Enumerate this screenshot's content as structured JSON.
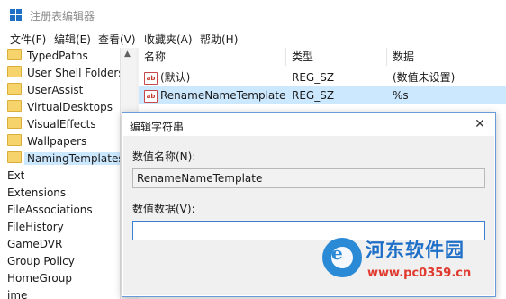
{
  "window": {
    "title": "注册表编辑器"
  },
  "menu": [
    "文件(F)",
    "编辑(E)",
    "查看(V)",
    "收藏夹(A)",
    "帮助(H)"
  ],
  "tree": {
    "folders": [
      "TypedPaths",
      "User Shell Folders",
      "UserAssist",
      "VirtualDesktops",
      "VisualEffects",
      "Wallpapers",
      "NamingTemplates"
    ],
    "keys": [
      "Ext",
      "Extensions",
      "FileAssociations",
      "FileHistory",
      "GameDVR",
      "Group Policy",
      "HomeGroup",
      "ime"
    ],
    "selected": "NamingTemplates"
  },
  "list": {
    "columns": [
      "名称",
      "类型",
      "数据"
    ],
    "rows": [
      {
        "name": "(默认)",
        "type": "REG_SZ",
        "data": "(数值未设置)",
        "icon": "ab-string-icon"
      },
      {
        "name": "RenameNameTemplate",
        "type": "REG_SZ",
        "data": "%s",
        "icon": "ab-string-icon"
      }
    ]
  },
  "dialog": {
    "title": "编辑字符串",
    "close_label": "✕",
    "name_label": "数值名称(N):",
    "name_value": "RenameNameTemplate",
    "data_label": "数值数据(V):",
    "data_value": ""
  },
  "watermark": {
    "name": "河东软件园",
    "url": "www.pc0359.cn"
  },
  "icon_ab": "ab",
  "colors": {
    "selection": "#cce8ff",
    "accent": "#3c7fd1",
    "folder": "#f6d36b"
  }
}
